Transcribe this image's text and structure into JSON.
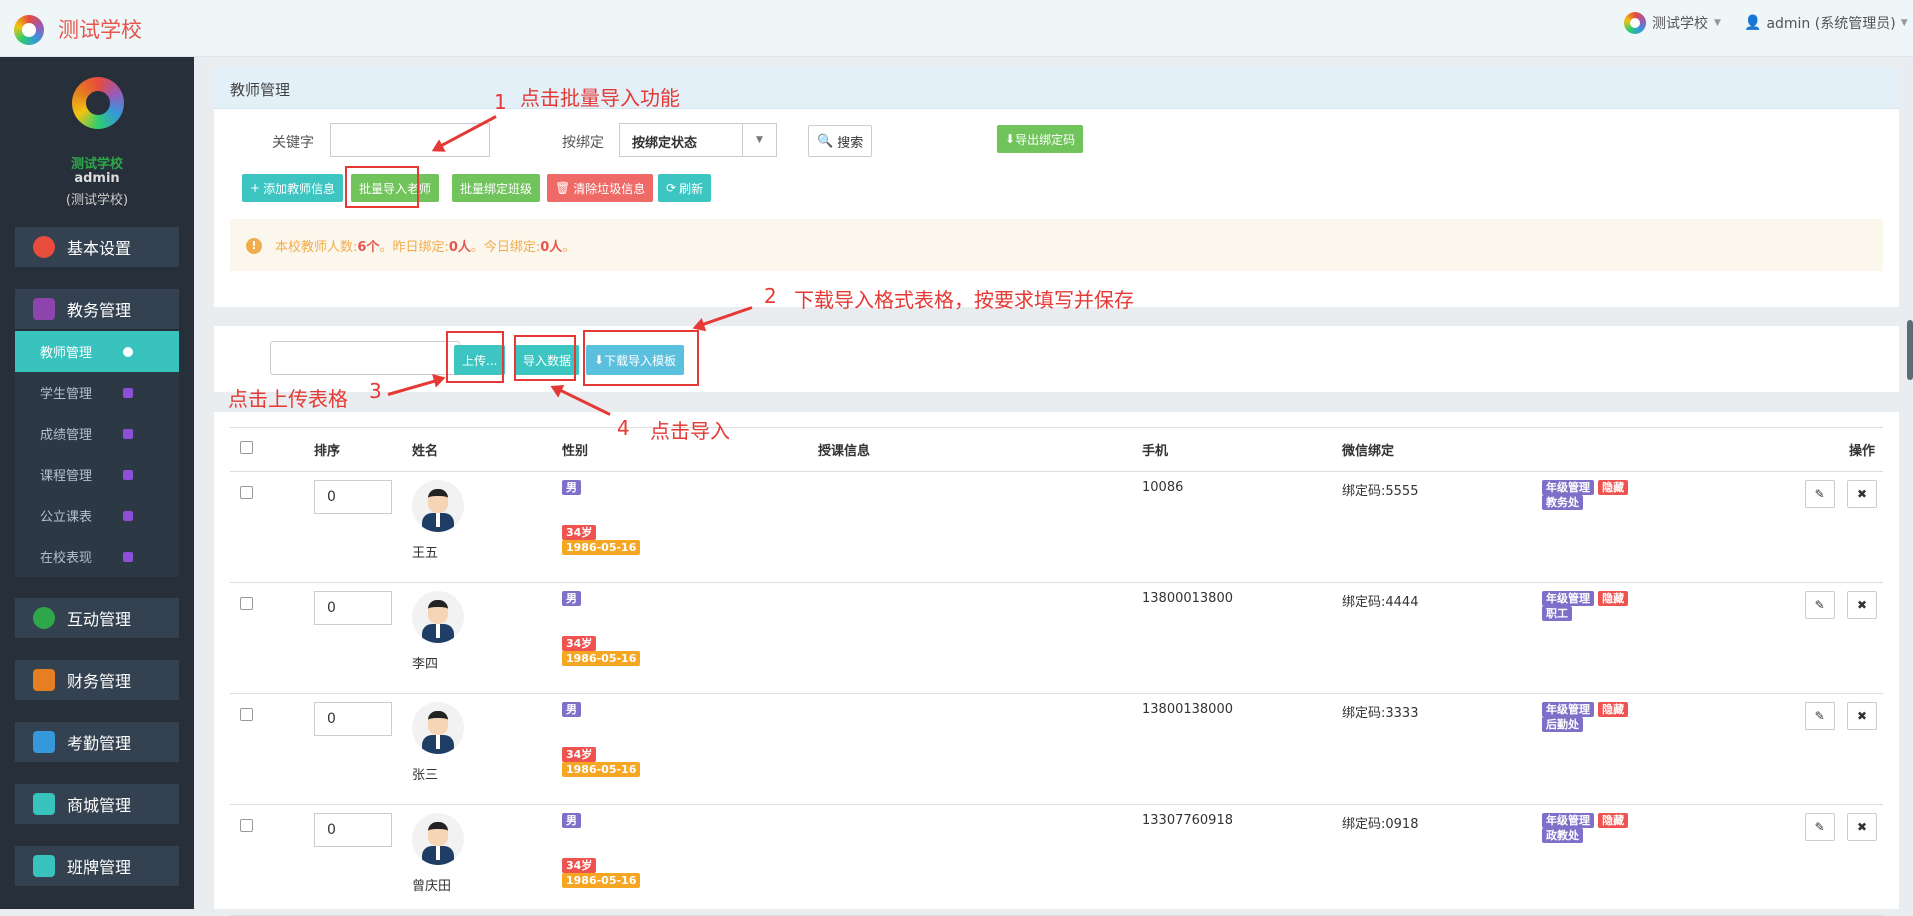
{
  "header": {
    "brand": "测试学校",
    "school": "测试学校",
    "user": "admin (系统管理员)"
  },
  "sidebar": {
    "school": "测试学校",
    "user": "admin",
    "role": "(测试学校)",
    "menus": [
      "基本设置",
      "教务管理",
      "互动管理",
      "财务管理",
      "考勤管理",
      "商城管理",
      "班牌管理"
    ],
    "subs": [
      "教师管理",
      "学生管理",
      "成绩管理",
      "课程管理",
      "公立课表",
      "在校表现"
    ]
  },
  "panel": {
    "title": "教师管理",
    "keyword_label": "关键字",
    "keyword_value": "",
    "bind_label": "按绑定",
    "bind_select": "按绑定状态",
    "search": "搜索",
    "export": "导出绑定码",
    "buttons": {
      "add": "添加教师信息",
      "batch_import": "批量导入老师",
      "batch_bind": "批量绑定班级",
      "clear": "清除垃圾信息",
      "refresh": "刷新"
    },
    "notice_a": "本校教师人数:",
    "notice_count": "6个",
    "notice_b": "。昨日绑定:",
    "notice_yesterday": "0人",
    "notice_c": "。今日绑定:",
    "notice_today": "0人",
    "notice_d": "。"
  },
  "upload": {
    "upload": "上传...",
    "import": "导入数据",
    "download": "下载导入模板"
  },
  "table": {
    "headers": [
      "排序",
      "姓名",
      "性别",
      "授课信息",
      "手机",
      "微信绑定",
      "操作"
    ],
    "rows": [
      {
        "order": "0",
        "name": "王五",
        "gender": "男",
        "age": "34岁",
        "birth": "1986-05-16",
        "phone": "10086",
        "bind": "绑定码:5555",
        "role": "年级管理",
        "hidden": "隐藏",
        "dept": "教务处"
      },
      {
        "order": "0",
        "name": "李四",
        "gender": "男",
        "age": "34岁",
        "birth": "1986-05-16",
        "phone": "13800013800",
        "bind": "绑定码:4444",
        "role": "年级管理",
        "hidden": "隐藏",
        "dept": "职工"
      },
      {
        "order": "0",
        "name": "张三",
        "gender": "男",
        "age": "34岁",
        "birth": "1986-05-16",
        "phone": "13800138000",
        "bind": "绑定码:3333",
        "role": "年级管理",
        "hidden": "隐藏",
        "dept": "后勤处"
      },
      {
        "order": "0",
        "name": "曾庆田",
        "gender": "男",
        "age": "34岁",
        "birth": "1986-05-16",
        "phone": "13307760918",
        "bind": "绑定码:0918",
        "role": "年级管理",
        "hidden": "隐藏",
        "dept": "政教处"
      }
    ]
  },
  "annotations": {
    "n1": "1",
    "t1": "点击批量导入功能",
    "n2": "2",
    "t2": "下载导入格式表格，按要求填写并保存",
    "n3": "3",
    "t3": "点击上传表格",
    "n4": "4",
    "t4": "点击导入"
  }
}
